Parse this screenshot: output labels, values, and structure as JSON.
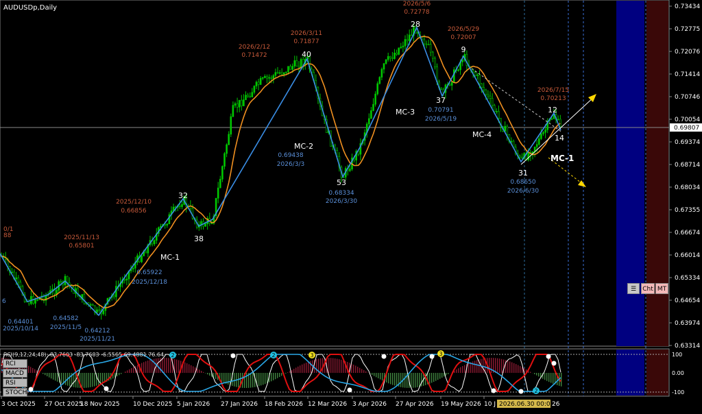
{
  "symbol_title": "AUDUSDp,Daily",
  "current_price": "0.69807",
  "price_ticks": [
    "0.73434",
    "0.72775",
    "0.72076",
    "0.71414",
    "0.70746",
    "0.70054",
    "0.69374",
    "0.68714",
    "0.68034",
    "0.67355",
    "0.66674",
    "0.66014",
    "0.65334",
    "0.64654",
    "0.63974",
    "0.63314"
  ],
  "time_ticks": [
    "3 Oct 2025",
    "27 Oct 2025",
    "18 Nov 2025",
    "10 Dec 2025",
    "5 Jan 2026",
    "27 Jan 2026",
    "18 Feb 2026",
    "12 Mar 2026",
    "3 Apr 2026",
    "27 Apr 2026",
    "19 May 2026",
    "10 J"
  ],
  "crosshair_time": "2026.06.30 00:00",
  "time_tail": "26",
  "left_edge": {
    "a": "0/1",
    "b": "88",
    "c": "6"
  },
  "annotations": {
    "p1": {
      "price": "0.64401",
      "date": "2025/10/14"
    },
    "p2": {
      "price": "0.64582",
      "date": "2025/11/5"
    },
    "p3": {
      "price": "0.64212",
      "date": "2025/11/21"
    },
    "p4": {
      "date": "2025/11/13",
      "price": "0.65801"
    },
    "p5": {
      "date": "2025/12/10",
      "price": "0.66856"
    },
    "p6": {
      "price": "0.65922",
      "date": "2025/12/18"
    },
    "p7": {
      "date": "2026/2/12",
      "price": "0.71472"
    },
    "p8": {
      "date": "2026/3/11",
      "price": "0.71877"
    },
    "p9": {
      "price": "0.69438",
      "date": "2026/3/3"
    },
    "p10": {
      "price": "0.68334",
      "date": "2026/3/30"
    },
    "p11": {
      "date": "2026/5/6",
      "price": "0.72778"
    },
    "p12": {
      "date": "2026/5/29",
      "price": "0.72007"
    },
    "p13": {
      "price": "0.70791",
      "date": "2026/5/19"
    },
    "p14": {
      "price": "0.68650",
      "date": "2026/6/30"
    },
    "p15": {
      "date": "2026/7/15",
      "price": "0.70213"
    }
  },
  "wave_labels": [
    "32",
    "38",
    "40",
    "53",
    "28",
    "37",
    "9",
    "31",
    "12",
    "14"
  ],
  "mc_labels": [
    "MC-1",
    "MC-2",
    "MC-3",
    "MC-4",
    "MC-1"
  ],
  "buttons": {
    "chart": "Cht",
    "mt": "MT"
  },
  "indicator_header": "RCI(9,12,24,48) -83.7603 -83.7603 -6.5565 69.4881 76.64",
  "indicator_buttons": [
    "RCI",
    "MACD",
    "RSI",
    "STOCH"
  ],
  "indicator_levels": [
    "100",
    "0.00",
    "-100"
  ],
  "signal_markers": [
    "2",
    "3",
    "2",
    "3",
    "2"
  ],
  "colors": {
    "bg": "#000000",
    "candle": "#00c800",
    "ma": "#f09020",
    "zigzag": "#3a8ee6",
    "red_label": "#c85a3a",
    "blue_label": "#5a8fd8",
    "rect_blue": "#000080",
    "rect_red": "#3a0808"
  }
}
